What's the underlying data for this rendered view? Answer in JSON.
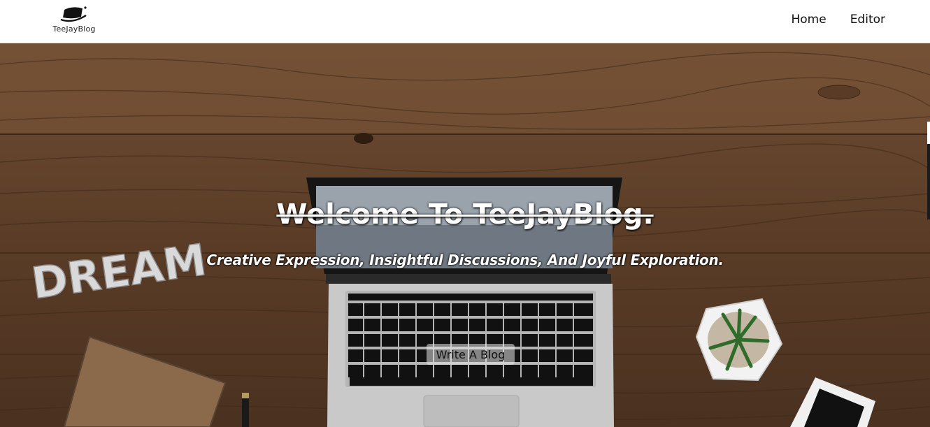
{
  "brand": {
    "name": "TeeJayBlog",
    "logo_icon": "laptop-swoosh-icon"
  },
  "nav": {
    "items": [
      {
        "label": "Home"
      },
      {
        "label": "Editor"
      }
    ]
  },
  "hero": {
    "headline": "Welcome To TeeJayBlog.",
    "tagline": "Creative Expression, Insightful Discussions, And Joyful Exploration.",
    "cta_label": "Write A Blog",
    "background_image": "wooden-desk-laptop-photo",
    "decor_text": "DREAM"
  },
  "colors": {
    "header_bg": "#ffffff",
    "nav_text": "#111111",
    "hero_text": "#ffffff",
    "wood": "#6b4a31"
  }
}
